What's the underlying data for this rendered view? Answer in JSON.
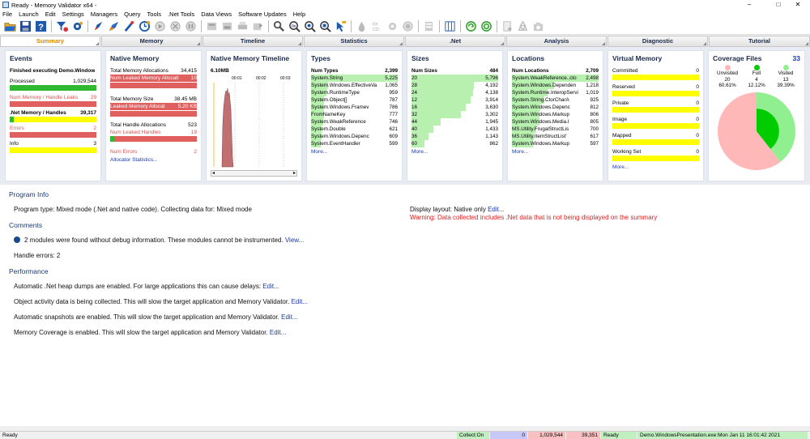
{
  "window": {
    "title": "Ready - Memory Validator x64 -",
    "minimize": "–",
    "maximize": "□",
    "close": "✕"
  },
  "menu": [
    "File",
    "Launch",
    "Edit",
    "Settings",
    "Managers",
    "Query",
    "Tools",
    ".Net Tools",
    "Data Views",
    "Software Updates",
    "Help"
  ],
  "tabs": [
    "Summary",
    "Memory",
    "Timeline",
    "Statistics",
    ".Net",
    "Analysis",
    "Diagnostic",
    "Tutorial"
  ],
  "events": {
    "title": "Events",
    "status": "Finished executing Demo.Window",
    "processed_label": "Processed",
    "processed_value": "1,029,544",
    "processed_fill": 1.0,
    "leaks_label": "Num Memory / Handle Leaks",
    "leaks_value": "29",
    "leaks_fill": 1.0,
    "net_label": ".Net Memory / Handles",
    "net_value": "39,317",
    "net_fill": 0.05,
    "errors_label": "Errors",
    "errors_value": "2",
    "errors_fill": 1.0,
    "info_label": "Info",
    "info_value": "3",
    "info_fill": 0.0
  },
  "native_memory": {
    "title": "Native Memory",
    "total_alloc_label": "Total Memory Allocations",
    "total_alloc_value": "34,415",
    "leaked_alloc_label": "Num Leaked Memory Allocati",
    "leaked_alloc_value": "10",
    "total_size_label": "Total Memory Size",
    "total_size_value": "38.45 MB",
    "leaked_size_label": "Leaked Memory Allocat",
    "leaked_size_value": "5.20 KB",
    "handle_alloc_label": "Total Handle Allocations",
    "handle_alloc_value": "523",
    "leaked_handles_label": "Num Leaked Handles",
    "leaked_handles_value": "19",
    "leaked_handles_fill": 0.05,
    "errors_label": "Num Errors",
    "errors_value": "2",
    "link": "Allocator Statistics..."
  },
  "timeline": {
    "title": "Native Memory Timeline",
    "max_label": "6.10MB",
    "ticks": [
      "00:01",
      "00:02",
      "00:03"
    ]
  },
  "types": {
    "title": "Types",
    "header_label": "Num Types",
    "header_value": "2,399",
    "rows": [
      {
        "name": "System.String",
        "value": "5,225",
        "fill": 1.0
      },
      {
        "name": "System.Windows.EffectiveVa",
        "value": "1,065",
        "fill": 0.2
      },
      {
        "name": "System.RuntimeType",
        "value": "959",
        "fill": 0.18
      },
      {
        "name": "System.Object[]",
        "value": "787",
        "fill": 0.15
      },
      {
        "name": "System.Windows.Framev",
        "value": "786",
        "fill": 0.15
      },
      {
        "name": "FromNameKey",
        "value": "777",
        "fill": 0.15
      },
      {
        "name": "System.WeakReference",
        "value": "746",
        "fill": 0.14
      },
      {
        "name": "System.Double",
        "value": "621",
        "fill": 0.12
      },
      {
        "name": "System.Windows.Depenc",
        "value": "609",
        "fill": 0.12
      },
      {
        "name": "System.EventHandler",
        "value": "599",
        "fill": 0.11
      }
    ],
    "more": "More..."
  },
  "sizes": {
    "title": "Sizes",
    "header_label": "Num Sizes",
    "header_value": "484",
    "rows": [
      {
        "name": "20",
        "value": "5,796",
        "fill": 1.0
      },
      {
        "name": "28",
        "value": "4,192",
        "fill": 0.72
      },
      {
        "name": "24",
        "value": "4,138",
        "fill": 0.71
      },
      {
        "name": "12",
        "value": "3,914",
        "fill": 0.68
      },
      {
        "name": "16",
        "value": "3,630",
        "fill": 0.63
      },
      {
        "name": "32",
        "value": "3,302",
        "fill": 0.57
      },
      {
        "name": "44",
        "value": "1,945",
        "fill": 0.34
      },
      {
        "name": "40",
        "value": "1,433",
        "fill": 0.25
      },
      {
        "name": "36",
        "value": "1,143",
        "fill": 0.2
      },
      {
        "name": "60",
        "value": "862",
        "fill": 0.15
      }
    ],
    "more": "More..."
  },
  "locations": {
    "title": "Locations",
    "header_label": "Num Locations",
    "header_value": "2,709",
    "rows": [
      {
        "name": "System.WeakReference..cto",
        "value": "2,498",
        "fill": 1.0
      },
      {
        "name": "System.Windows.Dependen",
        "value": "1,218",
        "fill": 0.49
      },
      {
        "name": "System.Runtime.InteropServi",
        "value": "1,019",
        "fill": 0.41
      },
      {
        "name": "System.String.CtorCharA",
        "value": "925",
        "fill": 0.37
      },
      {
        "name": "System.Windows.Depenc",
        "value": "812",
        "fill": 0.33
      },
      {
        "name": "System.Windows.Markup",
        "value": "806",
        "fill": 0.32
      },
      {
        "name": "System.Windows.Media.I",
        "value": "805",
        "fill": 0.32
      },
      {
        "name": "MS.Utility.FrugalStructLis",
        "value": "700",
        "fill": 0.28
      },
      {
        "name": "MS.Utility.ItemStructList'",
        "value": "617",
        "fill": 0.25
      },
      {
        "name": "System.Windows.Markup",
        "value": "597",
        "fill": 0.24
      }
    ],
    "more": "More..."
  },
  "virtual_memory": {
    "title": "Virtual Memory",
    "rows": [
      {
        "label": "Committed",
        "value": "0"
      },
      {
        "label": "Reserved",
        "value": "0"
      },
      {
        "label": "Private",
        "value": "0"
      },
      {
        "label": "Image",
        "value": "0"
      },
      {
        "label": "Mapped",
        "value": "0"
      },
      {
        "label": "Working Set",
        "value": "0"
      }
    ],
    "more": "More..."
  },
  "coverage": {
    "title": "Coverage Files",
    "total": "33",
    "legend": [
      {
        "label": "Unvisited",
        "count": "20",
        "pct": "60.61%",
        "color": "#ffb8b8"
      },
      {
        "label": "Full",
        "count": "4",
        "pct": "12.12%",
        "color": "#00cc00"
      },
      {
        "label": "Visited",
        "count": "13",
        "pct": "39.39%",
        "color": "#90f090"
      }
    ],
    "chart_data": {
      "type": "pie",
      "categories": [
        "Unvisited",
        "Full",
        "Visited"
      ],
      "values": [
        60.61,
        12.12,
        39.39
      ]
    }
  },
  "program_info": {
    "heading": "Program Info",
    "type_text": "Program type: Mixed mode (.Net and native code). Collecting data for: Mixed mode",
    "layout_text": "Display layout: Native only",
    "layout_link": "Edit...",
    "warning": "Warning: Data collected includes .Net data that is not being displayed on the summary"
  },
  "comments": {
    "heading": "Comments",
    "modules_text": "2 modules were found without debug information. These modules cannot be instrumented.",
    "modules_link": "View...",
    "handle_errors": "Handle errors: 2"
  },
  "performance": {
    "heading": "Performance",
    "items": [
      {
        "text": "Automatic .Net heap dumps are enabled. For large applications this can cause delays:",
        "link": "Edit..."
      },
      {
        "text": "Object activity data is being collected. This will slow the target application and Memory Validator.",
        "link": "Edit..."
      },
      {
        "text": "Automatic snapshots are enabled. This will slow the target application and Memory Validator.",
        "link": "Edit..."
      },
      {
        "text": "Memory Coverage is enabled. This will slow the target application and Memory Validator.",
        "link": "Edit..."
      }
    ]
  },
  "status": {
    "left": "Ready",
    "collect": "Collect:On",
    "mem": "0",
    "alloc": "1,029,544",
    "handles": "39,351",
    "state": "Ready",
    "target": "Demo.WindowsPresentation.exe:Mon Jan 11 16:01:42 2021"
  }
}
